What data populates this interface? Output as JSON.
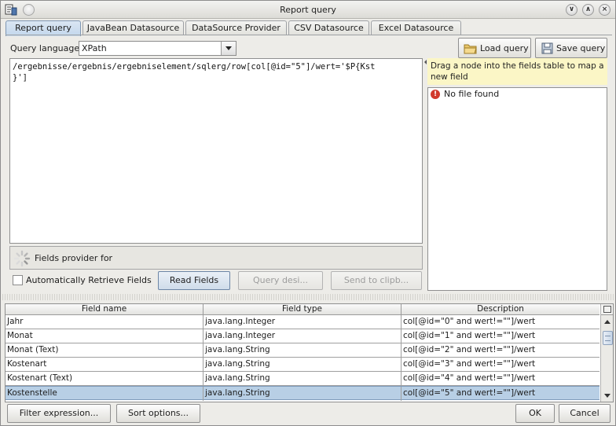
{
  "window": {
    "title": "Report query"
  },
  "tabs": [
    {
      "label": "Report query",
      "active": true
    },
    {
      "label": "JavaBean Datasource",
      "active": false
    },
    {
      "label": "DataSource Provider",
      "active": false
    },
    {
      "label": "CSV Datasource",
      "active": false
    },
    {
      "label": "Excel Datasource",
      "active": false
    }
  ],
  "query": {
    "language_label": "Query language",
    "language_value": "XPath",
    "text": "/ergebnisse/ergebnis/ergebniselement/sqlerg/row[col[@id=\"5\"]/wert='$P{Kst\n}']",
    "load_label": "Load query",
    "save_label": "Save query"
  },
  "provider": {
    "label": "Fields provider for",
    "auto_retrieve_label": "Automatically Retrieve Fields",
    "auto_retrieve_checked": false,
    "read_fields_label": "Read Fields",
    "query_designer_label": "Query desi...",
    "send_clipboard_label": "Send to clipb..."
  },
  "tree": {
    "hint": "Drag a node into the fields table to map a new field",
    "message": "No file found"
  },
  "fields_table": {
    "columns": [
      "Field name",
      "Field type",
      "Description"
    ],
    "rows": [
      {
        "name": "Jahr",
        "type": "java.lang.Integer",
        "description": "col[@id=\"0\" and wert!=\"\"]/wert",
        "selected": false
      },
      {
        "name": "Monat",
        "type": "java.lang.Integer",
        "description": "col[@id=\"1\" and wert!=\"\"]/wert",
        "selected": false
      },
      {
        "name": "Monat (Text)",
        "type": "java.lang.String",
        "description": "col[@id=\"2\" and wert!=\"\"]/wert",
        "selected": false
      },
      {
        "name": "Kostenart",
        "type": "java.lang.String",
        "description": "col[@id=\"3\" and wert!=\"\"]/wert",
        "selected": false
      },
      {
        "name": "Kostenart (Text)",
        "type": "java.lang.String",
        "description": "col[@id=\"4\" and wert!=\"\"]/wert",
        "selected": false
      },
      {
        "name": "Kostenstelle",
        "type": "java.lang.String",
        "description": "col[@id=\"5\" and wert!=\"\"]/wert",
        "selected": true
      }
    ]
  },
  "footer": {
    "filter_label": "Filter expression...",
    "sort_label": "Sort options...",
    "ok_label": "OK",
    "cancel_label": "Cancel"
  },
  "colors": {
    "selection": "#b8cfe5",
    "tab_active": "#c3d7ec",
    "hint_bg": "#fbf6c6",
    "error": "#d1392c"
  }
}
